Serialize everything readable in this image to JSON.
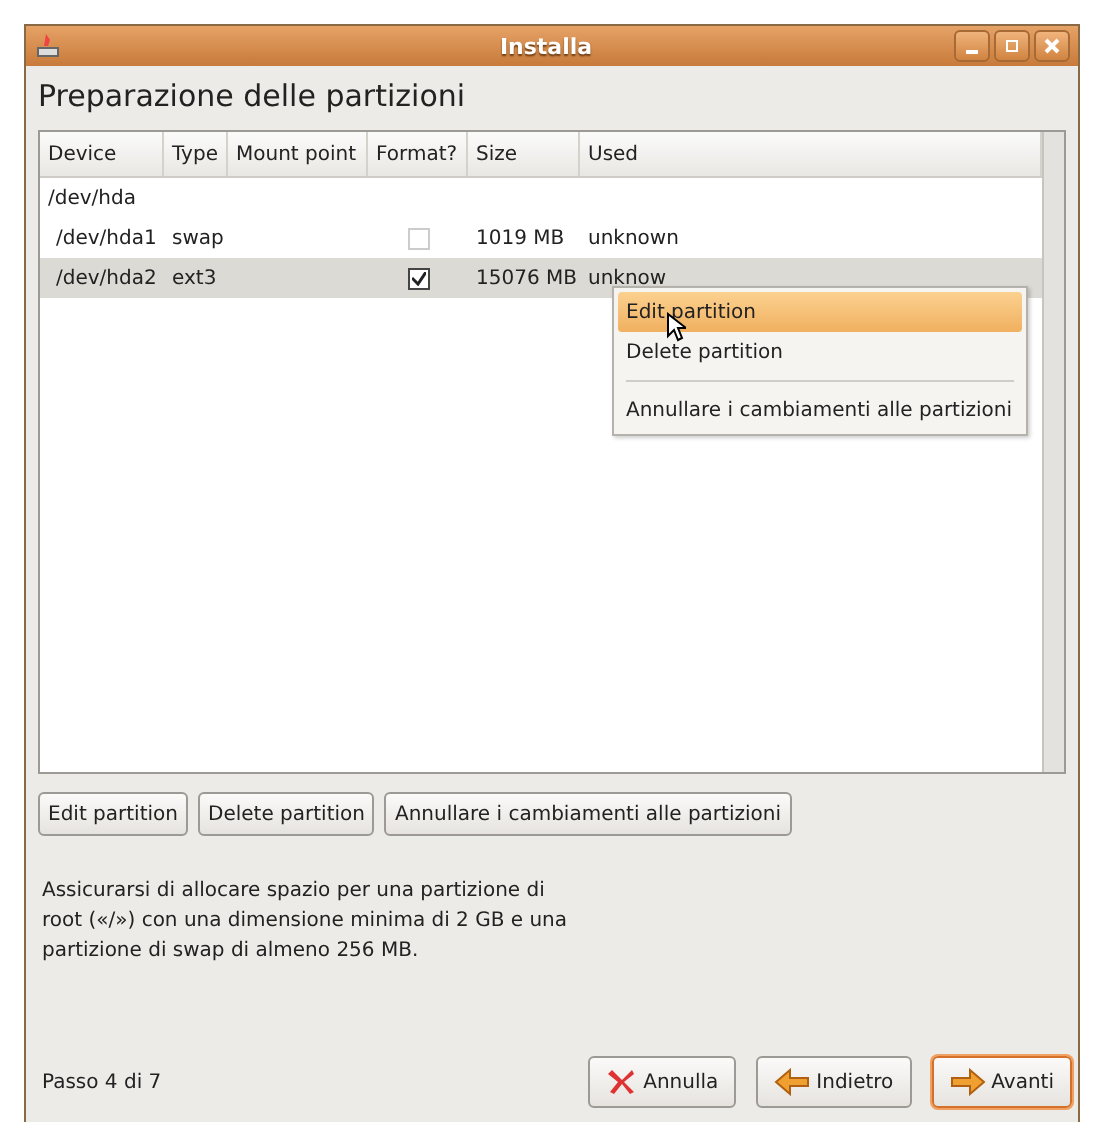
{
  "window": {
    "title": "Installa"
  },
  "heading": "Preparazione delle partizioni",
  "table": {
    "columns": [
      "Device",
      "Type",
      "Mount point",
      "Format?",
      "Size",
      "Used"
    ],
    "rows": [
      {
        "device": "/dev/hda",
        "indent": false,
        "selected": false
      },
      {
        "device": "/dev/hda1",
        "type": "swap",
        "format": false,
        "size": "1019 MB",
        "used": "unknown",
        "indent": true,
        "selected": false
      },
      {
        "device": "/dev/hda2",
        "type": "ext3",
        "format": true,
        "size": "15076 MB",
        "used": "unknow",
        "indent": true,
        "selected": true
      }
    ]
  },
  "context_menu": [
    {
      "label": "Edit partition",
      "selected": true
    },
    {
      "label": "Delete partition",
      "selected": false
    },
    {
      "kind": "separator"
    },
    {
      "label": "Annullare i cambiamenti alle partizioni",
      "selected": false
    }
  ],
  "buttons": [
    "Edit partition",
    "Delete partition",
    "Annullare i cambiamenti alle partizioni"
  ],
  "hint": "Assicurarsi di allocare spazio per una partizione di root («/») con una dimensione minima di 2 GB e una partizione di swap di almeno 256 MB.",
  "step": "Passo 4 di 7",
  "nav_buttons": [
    {
      "label": "Annulla",
      "kind": "cancel",
      "default": false
    },
    {
      "label": "Indietro",
      "kind": "back",
      "default": false
    },
    {
      "label": "Avanti",
      "kind": "forward",
      "default": true
    }
  ]
}
